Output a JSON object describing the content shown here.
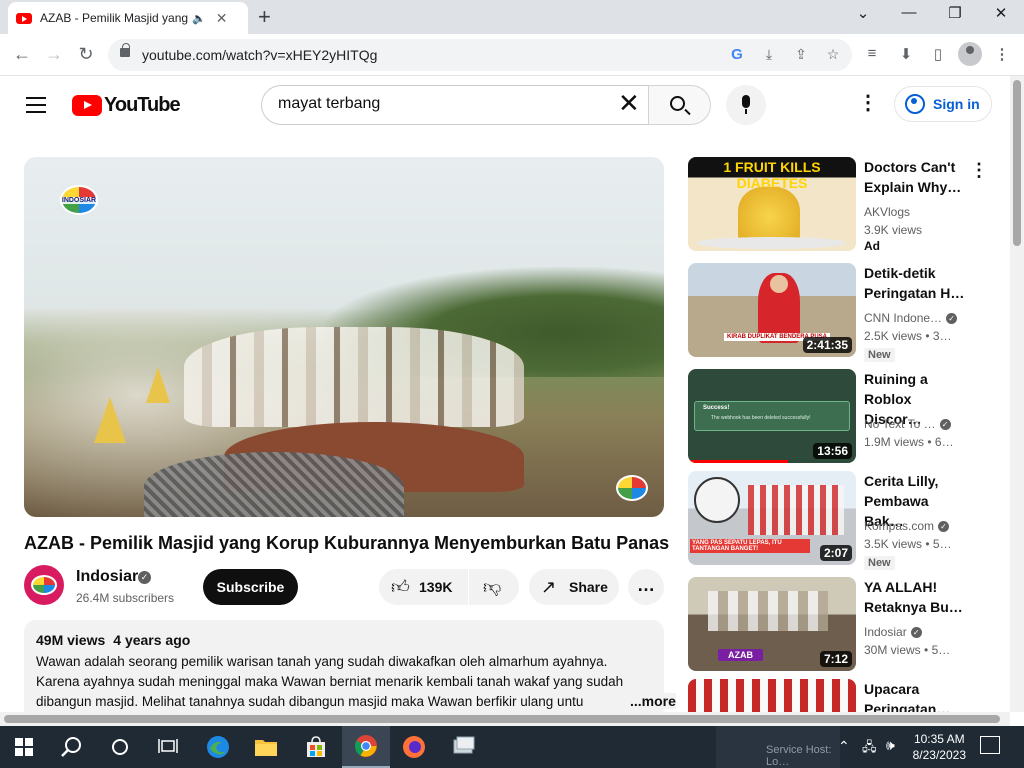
{
  "browser": {
    "tab_title": "AZAB - Pemilik Masjid yang Korup Kuburannya Menyemburkan Batu Panas",
    "tab_audio_icon": "speaker-icon",
    "tab_close": "✕",
    "new_tab": "+",
    "url": "youtube.com/watch?v=xHEY2yHITQg",
    "window_buttons": [
      "⌄",
      "—",
      "❐",
      "✕"
    ]
  },
  "youtube": {
    "logo_text": "YouTube",
    "search_value": "mayat terbang",
    "sign_in": "Sign in"
  },
  "video": {
    "title": "AZAB - Pemilik Masjid yang Korup Kuburannya Menyemburkan Batu Panas",
    "channel": "Indosiar",
    "subscribers": "26.4M subscribers",
    "subscribe": "Subscribe",
    "likes": "139K",
    "share": "Share",
    "views": "49M views",
    "age": "4 years ago",
    "description": "Wawan adalah seorang pemilik warisan tanah yang sudah diwakafkan oleh almarhum ayahnya. Karena ayahnya sudah meninggal maka Wawan berniat menarik kembali tanah wakaf yang sudah dibangun masjid. Melihat tanahnya sudah dibangun masjid maka Wawan berfikir ulang untu",
    "more": "...more",
    "watermark": "INDOSIAR"
  },
  "recommendations": [
    {
      "title": "Doctors Can't Explain Why…",
      "channel": "AKVlogs",
      "views": "3.9K views",
      "badge": "Ad",
      "duration": "",
      "thumb_text": "1 FRUIT KILLS DIABETES",
      "verified": false
    },
    {
      "title": "Detik-detik Peringatan H…",
      "channel": "CNN Indone…",
      "views": "2.5K views",
      "age": "• 3…",
      "badge": "New",
      "duration": "2:41:35",
      "thumb_text": "KIRAB DUPLIKAT BENDERA PUSA",
      "verified": true
    },
    {
      "title": "Ruining a Roblox Discor…",
      "channel": "No Text To …",
      "views": "1.9M views",
      "age": "• 6…",
      "badge": "",
      "duration": "13:56",
      "thumb_text": "Success!",
      "thumb_sub": "The webhook has been deleted successfully!",
      "verified": true
    },
    {
      "title": "Cerita Lilly, Pembawa Bak…",
      "channel": "Kompas.com",
      "views": "3.5K views",
      "age": "• 5…",
      "badge": "New",
      "duration": "2:07",
      "thumb_text": "YANG PAS SEPATU LEPAS, ITU TANTANGAN BANGET!",
      "verified": true
    },
    {
      "title": "YA ALLAH! Retaknya Bu…",
      "channel": "Indosiar",
      "views": "30M views",
      "age": "• 5…",
      "badge": "",
      "duration": "7:12",
      "thumb_text": "AZAB",
      "verified": true
    },
    {
      "title": "Upacara Peringatan…",
      "channel": "",
      "views": "",
      "badge": "",
      "duration": "",
      "thumb_text": "",
      "verified": false
    }
  ],
  "taskbar": {
    "time": "10:35 AM",
    "date": "8/23/2023",
    "hidden_label": "Service Host: Lo…"
  },
  "colors": {
    "yt_red": "#ff0000",
    "link_blue": "#065fd4",
    "taskbar": "#1f2a35"
  }
}
